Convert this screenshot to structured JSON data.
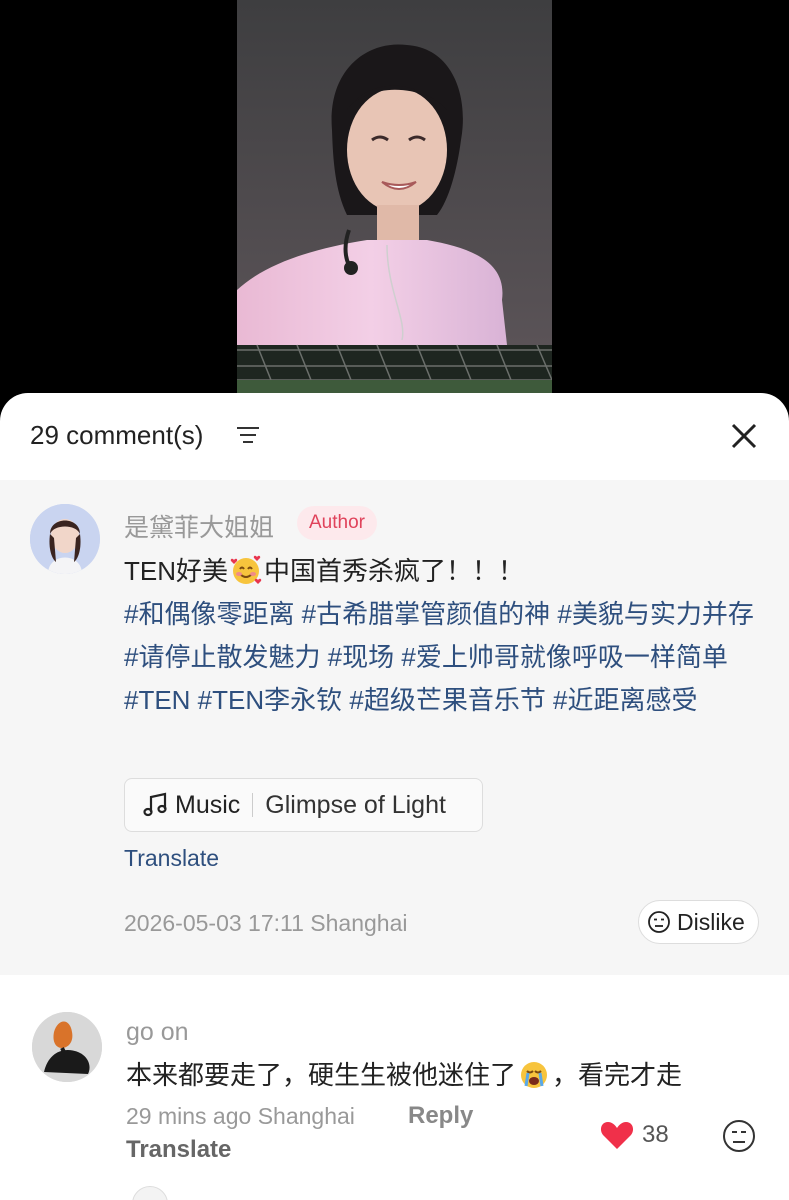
{
  "video": {
    "icon": "concert-performer-image"
  },
  "sheet": {
    "comment_count_label": "29 comment(s)",
    "filter_icon": "sort-filter-icon",
    "close_icon": "close-icon"
  },
  "author_post": {
    "username": "是黛菲大姐姐",
    "badge": "Author",
    "text_before_emoji": "TEN好美",
    "text_after_emoji": "中国首秀杀疯了！！！",
    "emoji": "smiling-face-with-hearts-emoji",
    "tags": "#和偶像零距离 #古希腊掌管颜值的神 #美貌与实力并存 #请停止散发魅力 #现场 #爱上帅哥就像呼吸一样简单 #TEN #TEN李永钦 #超级芒果音乐节 #近距离感受",
    "music_label": "Music",
    "music_title": "Glimpse of Light",
    "translate": "Translate",
    "timestamp": "2026-05-03 17:11 Shanghai",
    "dislike_label": "Dislike"
  },
  "comment": {
    "username": "go on",
    "text_before_emoji": "本来都要走了，硬生生被他迷住了",
    "emoji": "crying-face-emoji",
    "text_after_emoji": "，看完才走",
    "time": "29 mins ago Shanghai",
    "reply_label": "Reply",
    "translate": "Translate",
    "like_count": "38",
    "colors": {
      "heart": "#f0304a"
    }
  }
}
